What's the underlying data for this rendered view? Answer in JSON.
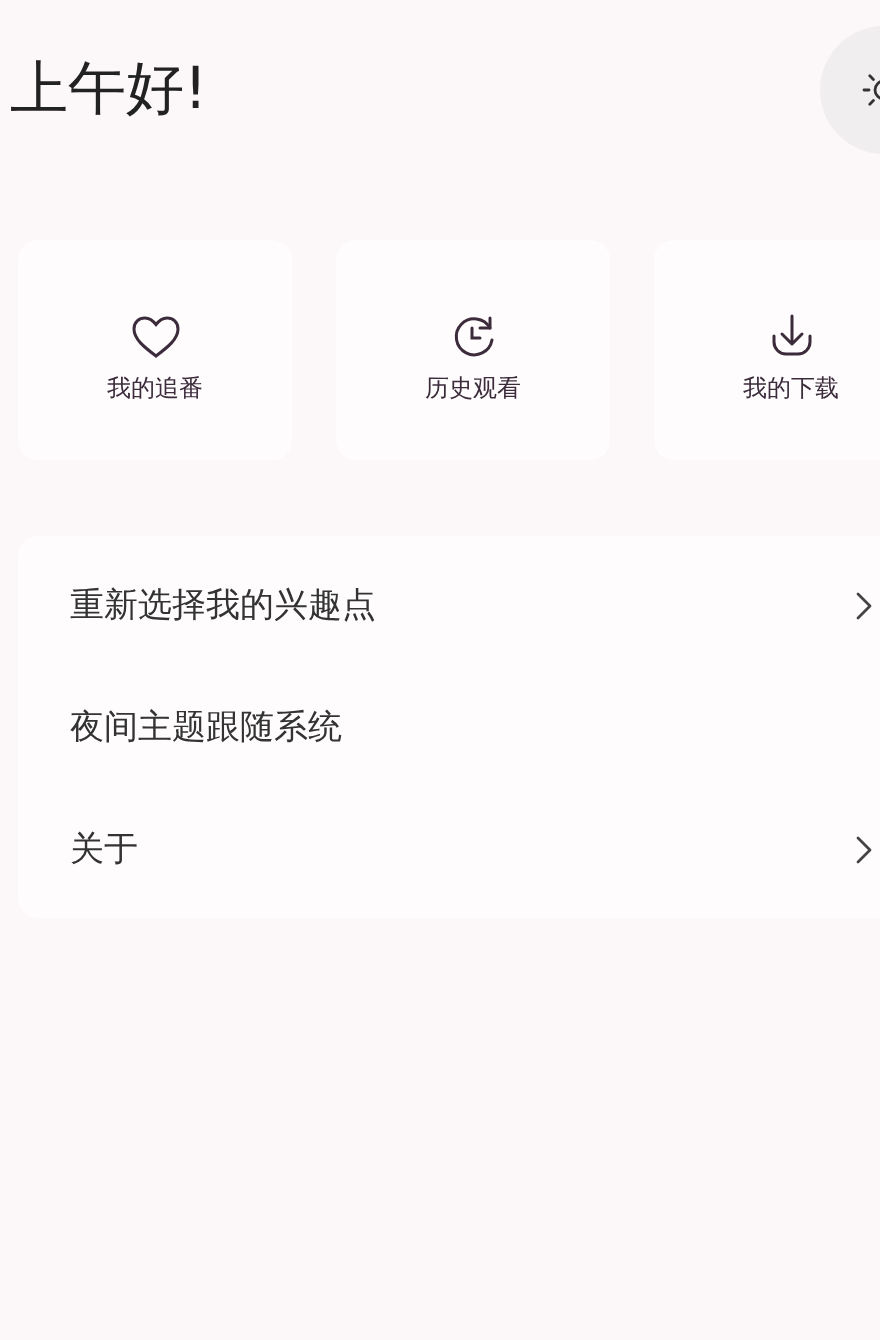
{
  "greeting": "上午好!",
  "theme_button": {
    "kind": "light"
  },
  "shortcuts": [
    {
      "label": "我的追番",
      "kind": "heart"
    },
    {
      "label": "历史观看",
      "kind": "history"
    },
    {
      "label": "我的下载",
      "kind": "download"
    }
  ],
  "settings": [
    {
      "label": "重新选择我的兴趣点",
      "chevron": true
    },
    {
      "label": "夜间主题跟随系统",
      "chevron": false
    },
    {
      "label": "关于",
      "chevron": true
    }
  ]
}
